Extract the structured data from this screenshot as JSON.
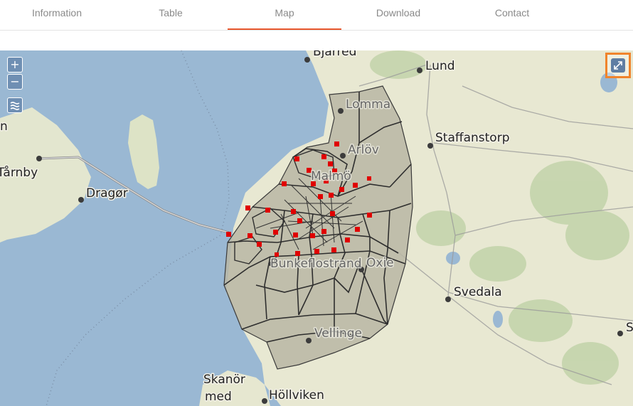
{
  "nav": {
    "tabs": [
      {
        "label": "Information"
      },
      {
        "label": "Table"
      },
      {
        "label": "Map"
      },
      {
        "label": "Download"
      },
      {
        "label": "Contact"
      }
    ],
    "active_tab": "Map",
    "accent_color": "#e8572e"
  },
  "map": {
    "controls": {
      "zoom_in": "+",
      "zoom_out": "−",
      "layers_icon": "layers-icon",
      "fullscreen_icon": "fullscreen-icon"
    },
    "places": {
      "bjarred": "Bjärred",
      "lund": "Lund",
      "lomma": "Lomma",
      "staffanstorp": "Staffanstorp",
      "arlov": "Arlöv",
      "malmo": "Malmö",
      "tarnby": "Tårnby",
      "dragor": "Dragør",
      "limhamn_partial": "n",
      "bunkeflostrand": "Bunkeflostrand",
      "oxie": "Oxie",
      "svedala": "Svedala",
      "vellinge": "Vellinge",
      "skanor_line1": "Skanör",
      "skanor_line2": "med",
      "hollviken": "Höllviken",
      "edge_partial": "S"
    },
    "colors": {
      "sea": "#9ab8d3",
      "land": "#e8e8d4",
      "region_fill": "#b9b7a6",
      "district_line": "#2e2e2e",
      "marker": "#e00000"
    }
  }
}
